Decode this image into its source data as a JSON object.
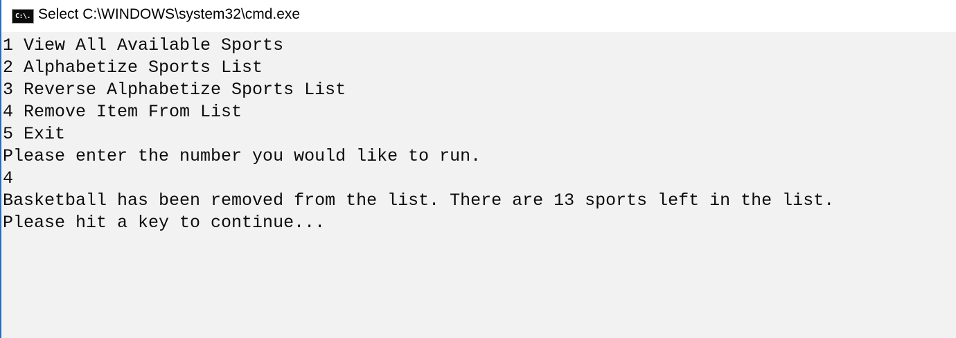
{
  "window": {
    "title": "Select C:\\WINDOWS\\system32\\cmd.exe",
    "icon": "cmd-icon",
    "icon_text": "C:\\."
  },
  "console": {
    "lines": [
      "1 View All Available Sports",
      "2 Alphabetize Sports List",
      "3 Reverse Alphabetize Sports List",
      "4 Remove Item From List",
      "5 Exit",
      "Please enter the number you would like to run.",
      "4",
      "Basketball has been removed from the list. There are 13 sports left in the list.",
      "Please hit a key to continue..."
    ]
  },
  "colors": {
    "console_background": "#f2f2f2",
    "console_text": "#0c0c0c",
    "titlebar_background": "#ffffff",
    "window_border": "#1f6fc5"
  }
}
